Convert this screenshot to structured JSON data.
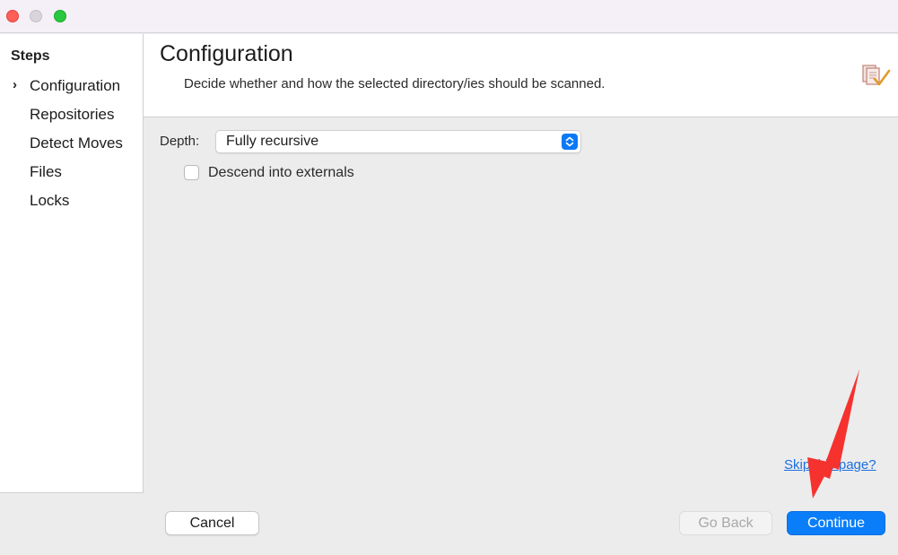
{
  "window": {
    "traffic_lights": [
      "close",
      "minimize",
      "zoom"
    ]
  },
  "sidebar": {
    "title": "Steps",
    "current_marker": "›",
    "items": [
      {
        "label": "Configuration",
        "active": true
      },
      {
        "label": "Repositories",
        "active": false
      },
      {
        "label": "Detect Moves",
        "active": false
      },
      {
        "label": "Files",
        "active": false
      },
      {
        "label": "Locks",
        "active": false
      }
    ]
  },
  "header": {
    "title": "Configuration",
    "description": "Decide whether and how the selected directory/ies should be scanned.",
    "icon": "documents-check-icon"
  },
  "form": {
    "depth_label": "Depth:",
    "depth_value": "Fully recursive",
    "descend_label": "Descend into externals",
    "descend_checked": false
  },
  "skip_link": "Skip this page?",
  "buttons": {
    "cancel": "Cancel",
    "go_back": "Go Back",
    "continue": "Continue"
  },
  "colors": {
    "accent": "#0a7df8",
    "annotation": "#f5322e"
  }
}
